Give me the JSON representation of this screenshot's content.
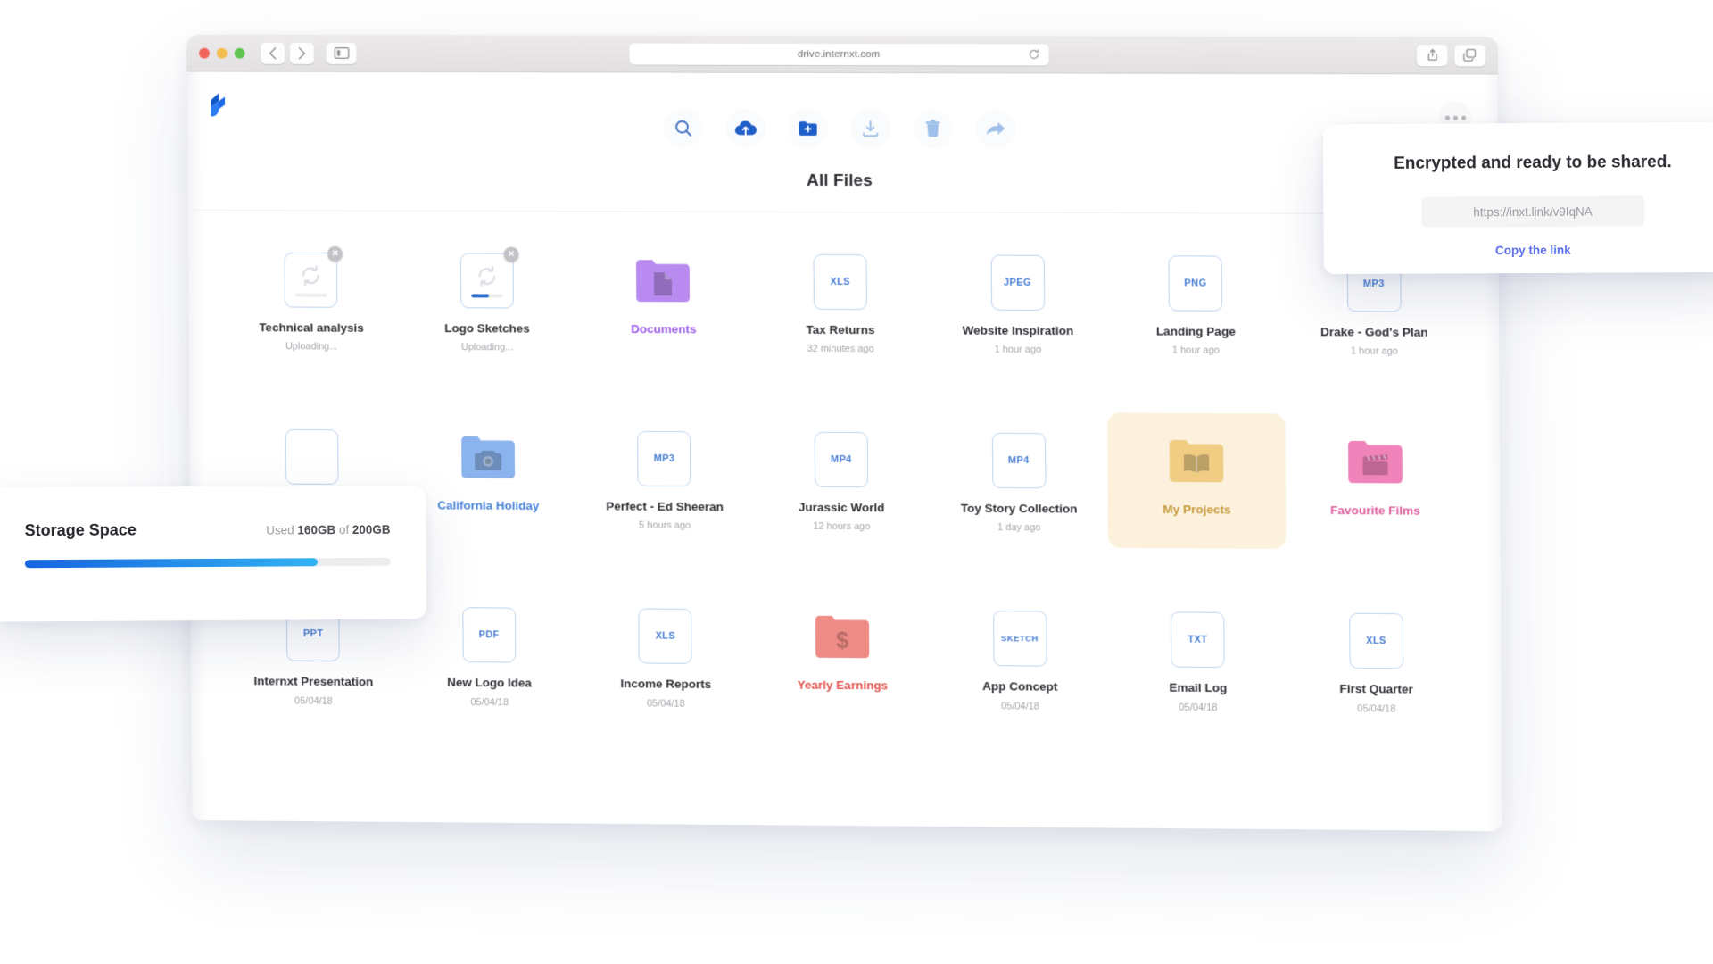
{
  "browser": {
    "url": "drive.internxt.com",
    "reload_icon": "reload-icon",
    "back_icon": "chevron-left-icon",
    "forward_icon": "chevron-right-icon",
    "sidebar_icon": "sidebar-toggle-icon",
    "share_icon": "share-icon",
    "tabs_icon": "tab-overview-icon",
    "traffic_lights": [
      "close",
      "minimize",
      "zoom"
    ]
  },
  "app": {
    "logo": "internxt-logo-icon",
    "page_title": "All Files",
    "overflow_menu": "kebab-menu-icon",
    "toolbar": [
      {
        "name": "search-icon",
        "label": "Search"
      },
      {
        "name": "cloud-upload-icon",
        "label": "Upload"
      },
      {
        "name": "folder-add-icon",
        "label": "New folder"
      },
      {
        "name": "download-icon",
        "label": "Download"
      },
      {
        "name": "trash-icon",
        "label": "Delete"
      },
      {
        "name": "share-arrow-icon",
        "label": "Share"
      }
    ]
  },
  "files": [
    {
      "name": "Technical analysis",
      "sub": "Uploading...",
      "kind": "uploading",
      "progress": 0,
      "selected": false,
      "cancelable": true
    },
    {
      "name": "Logo Sketches",
      "sub": "Uploading...",
      "kind": "uploading",
      "progress": 55,
      "selected": false,
      "cancelable": true
    },
    {
      "name": "Documents",
      "sub": "",
      "kind": "folder",
      "folder_icon": "document-icon",
      "color": "#b98bf0",
      "label_color": "#9b5fe8",
      "selected": false
    },
    {
      "name": "Tax Returns",
      "sub": "32 minutes ago",
      "kind": "file",
      "ext": "XLS"
    },
    {
      "name": "Website Inspiration",
      "sub": "1 hour ago",
      "kind": "file",
      "ext": "JPEG"
    },
    {
      "name": "Landing Page",
      "sub": "1 hour ago",
      "kind": "file",
      "ext": "PNG"
    },
    {
      "name": "Drake - God's Plan",
      "sub": "1 hour ago",
      "kind": "file",
      "ext": "MP3"
    },
    {
      "name": "",
      "sub": "",
      "kind": "file",
      "ext": ""
    },
    {
      "name": "California Holiday",
      "sub": "",
      "kind": "folder",
      "folder_icon": "camera-icon",
      "color": "#8bb4ee",
      "label_color": "#4a85d8",
      "selected": false
    },
    {
      "name": "Perfect - Ed Sheeran",
      "sub": "5 hours ago",
      "kind": "file",
      "ext": "MP3"
    },
    {
      "name": "Jurassic World",
      "sub": "12 hours ago",
      "kind": "file",
      "ext": "MP4"
    },
    {
      "name": "Toy Story Collection",
      "sub": "1 day ago",
      "kind": "file",
      "ext": "MP4"
    },
    {
      "name": "My Projects",
      "sub": "",
      "kind": "folder",
      "folder_icon": "book-icon",
      "color": "#f0cd83",
      "label_color": "#c89a3c",
      "selected": true
    },
    {
      "name": "Favourite Films",
      "sub": "",
      "kind": "folder",
      "folder_icon": "clapperboard-icon",
      "color": "#f183bb",
      "label_color": "#e05fa0",
      "selected": false
    },
    {
      "name": "Internxt Presentation",
      "sub": "05/04/18",
      "kind": "file",
      "ext": "PPT"
    },
    {
      "name": "New Logo Idea",
      "sub": "05/04/18",
      "kind": "file",
      "ext": "PDF"
    },
    {
      "name": "Income Reports",
      "sub": "05/04/18",
      "kind": "file",
      "ext": "XLS"
    },
    {
      "name": "Yearly Earnings",
      "sub": "",
      "kind": "folder",
      "folder_icon": "dollar-icon",
      "color": "#ef8c86",
      "label_color": "#e2564f",
      "selected": false
    },
    {
      "name": "App Concept",
      "sub": "05/04/18",
      "kind": "file",
      "ext": "SKETCH"
    },
    {
      "name": "Email Log",
      "sub": "05/04/18",
      "kind": "file",
      "ext": "TXT"
    },
    {
      "name": "First Quarter",
      "sub": "05/04/18",
      "kind": "file",
      "ext": "XLS"
    }
  ],
  "share_popup": {
    "title": "Encrypted and ready to be shared.",
    "link": "https://inxt.link/v9IqNA",
    "action": "Copy the link"
  },
  "storage": {
    "title": "Storage Space",
    "used_label_prefix": "Used ",
    "used": "160GB",
    "of_label": " of ",
    "total": "200GB",
    "percent": 80,
    "fill_from": "#1565e0",
    "fill_to": "#33b2f2"
  },
  "colors": {
    "accent_blue": "#2f6fd0",
    "file_border": "#bdd3ef",
    "ext_text": "#4a7fd4",
    "link_blue": "#5b6ee8",
    "selected_bg": "#fbf1dc"
  }
}
